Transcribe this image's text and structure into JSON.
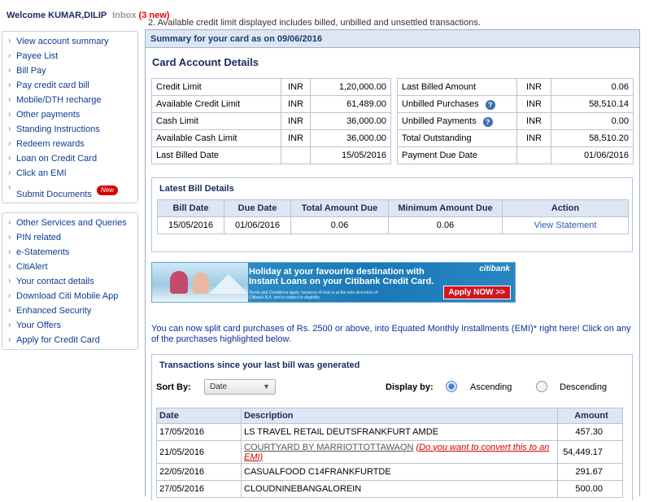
{
  "header": {
    "welcome": "Welcome KUMAR,DILIP",
    "inbox_label": "Inbox",
    "inbox_count": "(3 new)"
  },
  "note": "2. Available credit limit displayed includes billed, unbilled and unsettled transactions.",
  "sidebar": {
    "group1": [
      {
        "label": "View account summary"
      },
      {
        "label": "Payee List"
      },
      {
        "label": "Bill Pay"
      },
      {
        "label": "Pay credit card bill"
      },
      {
        "label": "Mobile/DTH recharge"
      },
      {
        "label": "Other payments"
      },
      {
        "label": "Standing Instructions"
      },
      {
        "label": "Redeem rewards"
      },
      {
        "label": "Loan on Credit Card"
      },
      {
        "label": "Click an EMI"
      },
      {
        "label": "Submit Documents",
        "badge": "New"
      }
    ],
    "group2": [
      {
        "label": "Other Services and Queries"
      },
      {
        "label": "PIN related"
      },
      {
        "label": "e-Statements"
      },
      {
        "label": "CitiAlert"
      },
      {
        "label": "Your contact details"
      },
      {
        "label": "Download Citi Mobile App"
      },
      {
        "label": "Enhanced Security"
      },
      {
        "label": "Your Offers"
      },
      {
        "label": "Apply for Credit Card"
      }
    ]
  },
  "summary": {
    "header": "Summary for your card as on 09/06/2016",
    "card_title": "Card Account Details",
    "left_rows": [
      {
        "label": "Credit Limit",
        "currency": "INR",
        "value": "1,20,000.00"
      },
      {
        "label": "Available Credit Limit",
        "currency": "INR",
        "value": "61,489.00"
      },
      {
        "label": "Cash Limit",
        "currency": "INR",
        "value": "36,000.00"
      },
      {
        "label": "Available Cash Limit",
        "currency": "INR",
        "value": "36,000.00"
      },
      {
        "label": "Last Billed Date",
        "currency": "",
        "value": "15/05/2016"
      }
    ],
    "right_rows": [
      {
        "label": "Last Billed Amount",
        "currency": "INR",
        "value": "0.06",
        "help": ""
      },
      {
        "label": "Unbilled Purchases",
        "currency": "INR",
        "value": "58,510.14",
        "help": "?"
      },
      {
        "label": "Unbilled Payments",
        "currency": "INR",
        "value": "0.00",
        "help": "?"
      },
      {
        "label": "Total Outstanding",
        "currency": "INR",
        "value": "58,510.20",
        "help": ""
      },
      {
        "label": "Payment Due Date",
        "currency": "",
        "value": "01/06/2016",
        "help": ""
      }
    ]
  },
  "latest_bill": {
    "title": "Latest Bill Details",
    "columns": [
      "Bill Date",
      "Due Date",
      "Total Amount Due",
      "Minimum Amount Due",
      "Action"
    ],
    "row": {
      "bill_date": "15/05/2016",
      "due_date": "01/06/2016",
      "total_due": "0.06",
      "min_due": "0.06",
      "action": "View Statement"
    }
  },
  "banner": {
    "line1": "Holiday at your favourite destination with",
    "line2": "Instant Loans on your Citibank Credit Card.",
    "terms": "Terms and Conditions apply. Issuance of loan is at the sole discretion of Citibank N.A. and is subject to eligibility.",
    "brand": "citibank",
    "apply": "Apply NOW >>"
  },
  "emi_text": "You can now split card purchases of Rs. 2500 or above, into Equated Monthly Installments (EMI)* right here! Click on any of the purchases highlighted below.",
  "transactions": {
    "title": "Transactions since your last bill was generated",
    "sort_by_label": "Sort By:",
    "sort_by_value": "Date",
    "display_by_label": "Display by:",
    "ascending": "Ascending",
    "descending": "Descending",
    "columns": [
      "Date",
      "Description",
      "Amount"
    ],
    "rows": [
      {
        "date": "17/05/2016",
        "desc": "LS TRAVEL RETAIL DEUTSFRANKFURT AMDE",
        "emi": "",
        "amount": "457.30"
      },
      {
        "date": "21/05/2016",
        "desc": "COURTYARD BY MARRIOTTOTTAWAON",
        "emi": "(Do you want to convert this to an EMI)",
        "amount": "54,449.17"
      },
      {
        "date": "22/05/2016",
        "desc": "CASUALFOOD C14FRANKFURTDE",
        "emi": "",
        "amount": "291.67"
      },
      {
        "date": "27/05/2016",
        "desc": "CLOUDNINEBANGALOREIN",
        "emi": "",
        "amount": "500.00"
      }
    ]
  }
}
